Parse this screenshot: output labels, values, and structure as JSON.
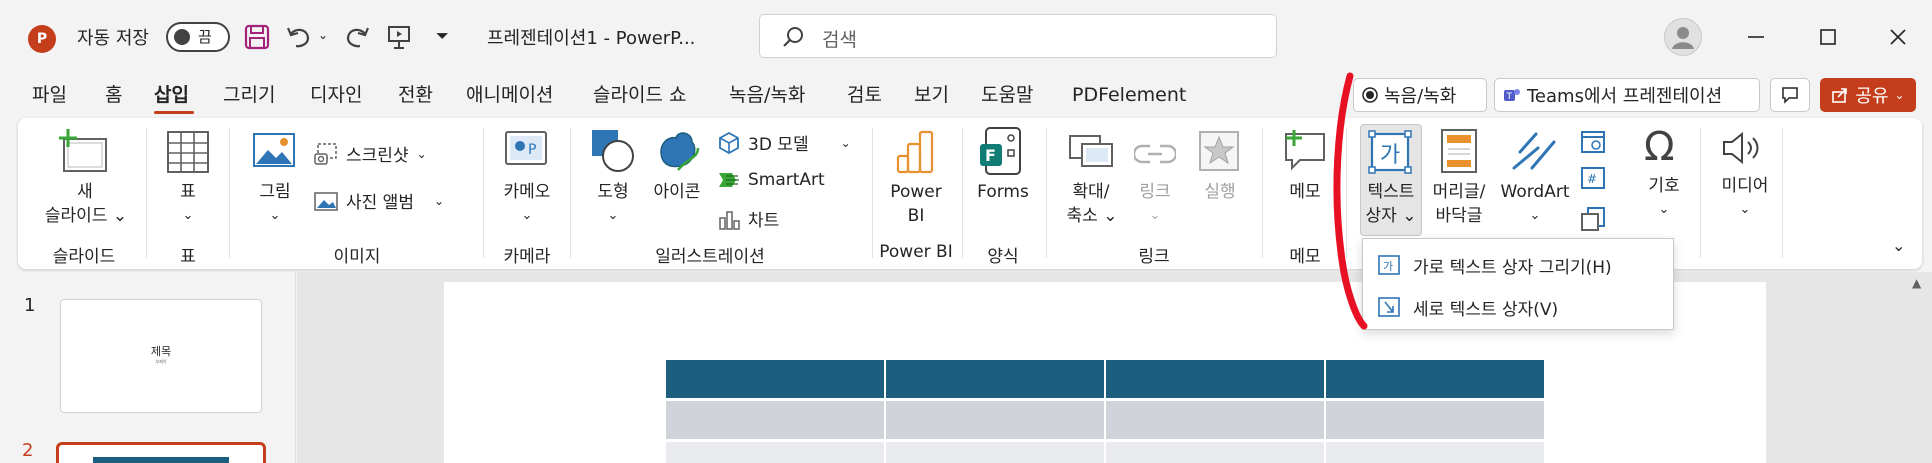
{
  "titlebar": {
    "app_logo": "P",
    "autosave_label": "자동 저장",
    "autosave_state": "끔",
    "doc_title": "프레젠테이션1  -  PowerP...",
    "search_placeholder": "검색"
  },
  "tabs": [
    "파일",
    "홈",
    "삽입",
    "그리기",
    "디자인",
    "전환",
    "애니메이션",
    "슬라이드 쇼",
    "녹음/녹화",
    "검토",
    "보기",
    "도움말",
    "PDFelement"
  ],
  "active_tab": "삽입",
  "top_right": {
    "record_label": "녹음/녹화",
    "teams_label": "Teams에서 프레젠테이션",
    "share_label": "공유"
  },
  "ribbon": {
    "new_slide": [
      "새",
      "슬라이드"
    ],
    "table": "표",
    "pictures": "그림",
    "screenshot": "스크린샷",
    "photo_album": "사진 앨범",
    "cameo": "카메오",
    "shapes": "도형",
    "icons": "아이콘",
    "model3d": "3D 모델",
    "smartart": "SmartArt",
    "chart": "차트",
    "powerbi": [
      "Power",
      "BI"
    ],
    "forms": "Forms",
    "zoom": [
      "확대/",
      "축소"
    ],
    "link": "링크",
    "action": "실행",
    "comment": "메모",
    "textbox": [
      "텍스트",
      "상자"
    ],
    "header_footer": [
      "머리글/",
      "바닥글"
    ],
    "wordart": "WordArt",
    "textbox_icon_text": "가",
    "symbols": "기호",
    "media": "미디어"
  },
  "groups": {
    "slides": "슬라이드",
    "tables": "표",
    "images": "이미지",
    "camera": "카메라",
    "illustrations": "일러스트레이션",
    "powerbi": "Power BI",
    "forms": "양식",
    "links": "링크",
    "comments": "메모"
  },
  "dropdown": {
    "horizontal": "가로 텍스트 상자 그리기(H)",
    "vertical": "세로 텍스트 상자(V)"
  },
  "thumbnails": [
    {
      "number": "1",
      "title": "제목",
      "subtitle": "부제목"
    },
    {
      "number": "2"
    }
  ],
  "colors": {
    "accent": "#c43e1c",
    "table_header": "#1b5e80",
    "table_row_alt": "#d0d3d9",
    "table_row": "#e9ebef",
    "annotation_red": "#e81123"
  }
}
